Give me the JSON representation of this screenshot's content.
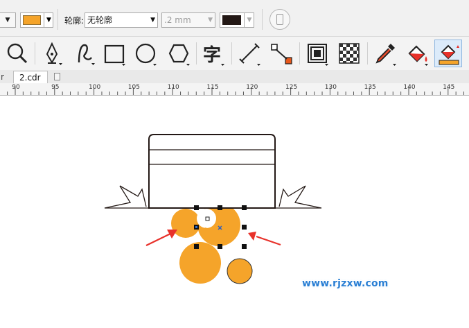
{
  "property_bar": {
    "fill_label": "",
    "fill_color": "#f5a42a",
    "outline_label": "轮廓:",
    "outline_value": "无轮廓",
    "width_value": ".2 mm",
    "outline_color": "#231815"
  },
  "toolbox": {
    "tools": [
      "zoom-tool",
      "pen-tool",
      "freehand-tool",
      "rectangle-tool",
      "ellipse-tool",
      "polygon-tool",
      "text-tool",
      "dimension-tool",
      "connector-tool",
      "contour-tool",
      "transparency-tool",
      "eyedropper-tool",
      "fill-tool",
      "smart-fill-tool"
    ],
    "text_tool_glyph": "字"
  },
  "tabs": {
    "partial_tab": "r",
    "active_tab": "2.cdr"
  },
  "ruler": {
    "labels": [
      "90",
      "95",
      "100",
      "105",
      "110",
      "115",
      "120",
      "125",
      "130",
      "135",
      "140",
      "145"
    ],
    "unit": "mm"
  },
  "canvas": {
    "accent_color": "#f5a42a",
    "arrow_color": "#e8312a",
    "outline_color": "#231815"
  },
  "watermark": "www.rjzxw.com"
}
